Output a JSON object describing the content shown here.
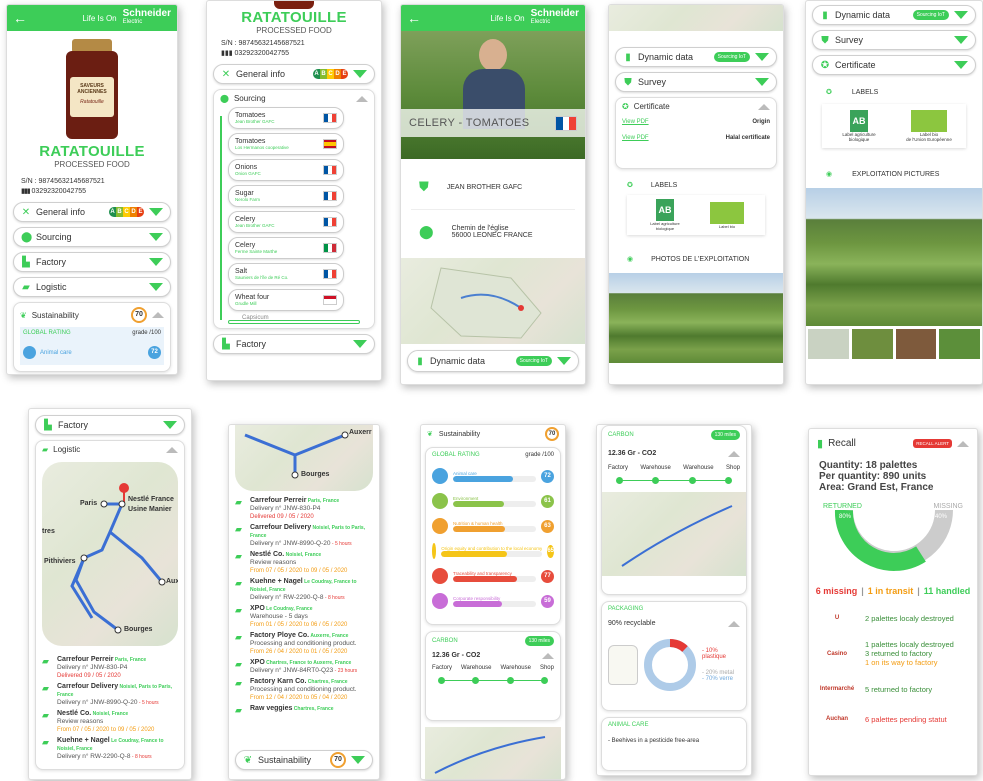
{
  "header": {
    "life_is_on": "Life Is On",
    "brand": "Schneider",
    "brand_sub": "Electric"
  },
  "product": {
    "title": "RATATOUILLE",
    "subtitle": "PROCESSED FOOD",
    "sn": "S/N : 98745632145687521",
    "barcode": "03292320042755"
  },
  "jar_label": {
    "line1": "SAVEURS",
    "line2": "ANCIENNES",
    "line3": "Ratatouille"
  },
  "nutri": [
    "A",
    "B",
    "C",
    "D",
    "E"
  ],
  "menu": {
    "general_info": "General info",
    "sourcing": "Sourcing",
    "factory": "Factory",
    "logistic": "Logistic",
    "sustainability": "Sustainability",
    "dynamic_data": "Dynamic data",
    "survey": "Survey",
    "certificate": "Certificate",
    "sourcing_badge": "Sourcing IoT"
  },
  "sustain_score": "70",
  "global_rating": {
    "title": "GLOBAL RATING",
    "grade": "grade /100",
    "first_item": "Animal care",
    "first_value": "72"
  },
  "sourcing_items": [
    {
      "name": "Tomatoes",
      "sub": "Jean Brother GAFC",
      "flag": "fr"
    },
    {
      "name": "Tomatoes",
      "sub": "Los Hermanos cooperative",
      "flag": "es"
    },
    {
      "name": "Onions",
      "sub": "Onion GAFC",
      "flag": "fr"
    },
    {
      "name": "Sugar",
      "sub": "Nerolo Farm",
      "flag": "fr"
    },
    {
      "name": "Celery",
      "sub": "Jean Brother GAFC",
      "flag": "fr"
    },
    {
      "name": "Celery",
      "sub": "Ferme Sainte Marthe",
      "flag": "it"
    },
    {
      "name": "Salt",
      "sub": "Sauniers de l'île de Ré Co.",
      "flag": "fr"
    },
    {
      "name": "Wheat four",
      "sub": "Grudle Mill",
      "flag": "id"
    }
  ],
  "sourcing_cut": "Capsicum",
  "farm": {
    "photo_caption": "CELERY - TOMATOES",
    "farmer": "JEAN BROTHER GAFC",
    "address1": "Chemin de l'église",
    "address2": "56000 LEONEC FRANCE"
  },
  "cert": {
    "view_pdf": "View PDF",
    "origin": "Origin",
    "halal": "Halal certificate",
    "labels": "LABELS",
    "photos_fr": "PHOTOS DE L'EXPLOITATION",
    "photos_en": "EXPLOITATION PICTURES",
    "label1_a": "Label agriculture",
    "label1_b": "biologique",
    "label2_a": "Label bio",
    "label2_b": "de l'Union Européenne",
    "label_line_run": "Label bio de l'union européenne et de la présente"
  },
  "logistic_map": {
    "nestle": "Nestlé France",
    "usine": "Usine Manier",
    "paris": "Paris",
    "pithiviers": "Pithiviers",
    "bourges": "Bourges",
    "auxerre": "Auxerre",
    "tres": "tres",
    "auxerre_cut": "Auxerr"
  },
  "shipments": [
    {
      "name": "Carrefour Perreir",
      "place": "Paris, France",
      "line": "Delivery n° JNW-830-P4",
      "status": "Delivered 09 / 05 / 2020",
      "status_color": "red",
      "extra": ""
    },
    {
      "name": "Carrefour Delivery",
      "place": "Noisiel, Paris to Paris, France",
      "line": "Delivery n° JNW-8990-Q-20",
      "status": "",
      "status_color": "",
      "extra": "- 5 hours"
    },
    {
      "name": "Nestlé Co.",
      "place": "Noisiel, France",
      "line": "Review reasons",
      "status": "From 07 / 05 / 2020 to 09 / 05 / 2020",
      "status_color": "orange",
      "extra": ""
    },
    {
      "name": "Kuehne + Nagel",
      "place": "Le Coudray, France to Noisiel, France",
      "line": "Delivery n° RW-2290-Q-8",
      "status": "",
      "status_color": "",
      "extra": "- 8 hours"
    },
    {
      "name": "XPO",
      "place": "Le Coudray, France",
      "line": "Warehouse - 5 days",
      "status": "From 01 / 05 / 2020 to 06 / 05 / 2020",
      "status_color": "orange",
      "extra": ""
    },
    {
      "name": "Factory Ploye Co.",
      "place": "Auxerre, France",
      "line": "Processing and conditioning product.",
      "status": "From 26 / 04 / 2020 to 01 / 05 / 2020",
      "status_color": "orange",
      "extra": ""
    },
    {
      "name": "XPO",
      "place": "Chartres, France to Auxerre, France",
      "line": "Delivery n° JNW-84RT0-Q23",
      "status": "",
      "status_color": "",
      "extra": "- 23 hours"
    },
    {
      "name": "Factory Karn Co.",
      "place": "Chartres, France",
      "line": "Processing and conditioning product.",
      "status": "From 12 / 04 / 2020 to 05 / 04 / 2020",
      "status_color": "orange",
      "extra": ""
    },
    {
      "name": "Raw veggies",
      "place": "Chartres, France",
      "line": "",
      "status": "",
      "status_color": "",
      "extra": ""
    }
  ],
  "shipments_short": [
    {
      "name": "Carrefour Perreir",
      "place": "Paris, France",
      "line": "Delivery n° JNW-830-P4",
      "status": "Delivered 09 / 05 / 2020",
      "status_color": "red",
      "extra": ""
    },
    {
      "name": "Carrefour Delivery",
      "place": "Noisiel, Paris to Paris, France",
      "line": "Delivery n° JNW-8990-Q-20",
      "status": "",
      "status_color": "",
      "extra": "- 5 hours"
    },
    {
      "name": "Nestlé Co.",
      "place": "Noisiel, France",
      "line": "Review reasons",
      "status": "From 07 / 05 / 2020 to 09 / 05 / 2020",
      "status_color": "orange",
      "extra": ""
    },
    {
      "name": "Kuehne + Nagel",
      "place": "Le Coudray, France to Noisiel, France",
      "line": "Delivery n° RW-2290-Q-8",
      "status": "",
      "status_color": "",
      "extra": "- 8 hours"
    }
  ],
  "ratings": [
    {
      "label": "Animal care",
      "value": "72",
      "color": "#4aa3df",
      "pct": 72
    },
    {
      "label": "Environment",
      "value": "61",
      "color": "#8bc34a",
      "pct": 61
    },
    {
      "label": "Nutrition & human health",
      "value": "63",
      "color": "#f0a030",
      "pct": 63
    },
    {
      "label": "Origin equity and contribution to the local economy",
      "value": "65",
      "color": "#f5c518",
      "pct": 65
    },
    {
      "label": "Traceability and transparency",
      "value": "77",
      "color": "#e74c3c",
      "pct": 77
    },
    {
      "label": "Corporate responsibility",
      "value": "59",
      "color": "#c86dd7",
      "pct": 59
    }
  ],
  "carbon": {
    "title": "CARBON",
    "badge": "130 miles",
    "value": "12.36 Gr - CO2",
    "steps": [
      "Factory",
      "Warehouse",
      "Warehouse",
      "Shop"
    ]
  },
  "packaging": {
    "title": "PACKAGING",
    "recyclable": "90% recyclable",
    "plastique": "- 10% plastique",
    "metal": "- 20% metal",
    "verre": "- 70% verre",
    "animal_care": "ANIMAL CARE",
    "animal_line": "- Beehives in a pesticide free-area"
  },
  "recall": {
    "title": "Recall",
    "badge": "RECALL ALERT",
    "quantity": "Quantity: 18 palettes",
    "per_qty": "Per quantity: 890 units",
    "area": "Area: Grand Est, France",
    "returned": "RETURNED",
    "missing": "MISSING",
    "pct_green": "80%",
    "pct_grey": "40%",
    "missing_count": "6 missing",
    "sep": "|",
    "transit": "1 in transit",
    "handled": "11 handled"
  },
  "recall_items": [
    {
      "logo": "U",
      "text": "2 palettes localy destroyed",
      "color": "#3a8f3a"
    },
    {
      "logo": "Casino",
      "text": "1 palettes localy destroyed",
      "text2": "3 returned to factory",
      "text3": "1 on its way to factory",
      "color": "#3a8f3a"
    },
    {
      "logo": "Intermarché",
      "text": "5 returned to factory",
      "color": "#3a8f3a"
    },
    {
      "logo": "Auchan",
      "text": "6 palettes pending statut",
      "color": "#e53935"
    }
  ],
  "colors": {
    "brand": "#3dcd58"
  }
}
